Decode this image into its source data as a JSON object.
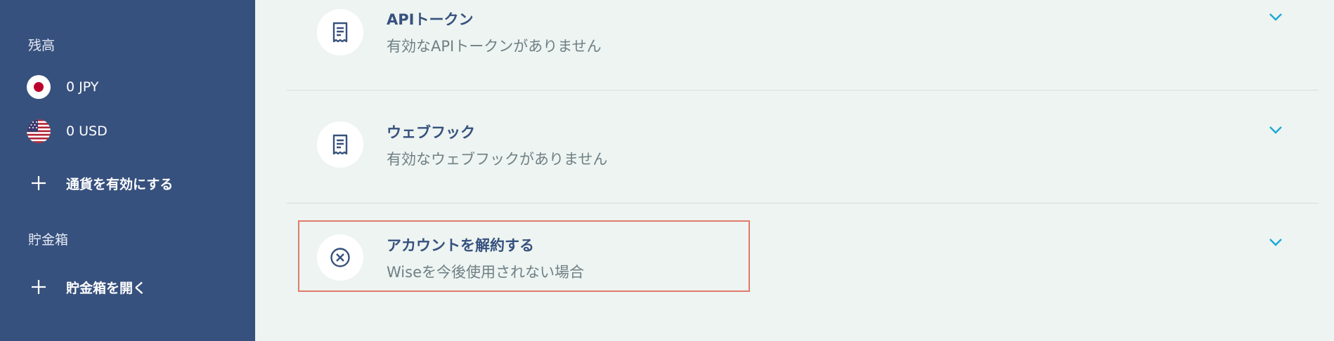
{
  "sidebar": {
    "balance_heading": "残高",
    "currencies": [
      {
        "label": "0 JPY",
        "flag": "jp-flag-icon"
      },
      {
        "label": "0 USD",
        "flag": "us-flag-icon"
      }
    ],
    "enable_currency": "通貨を有効にする",
    "jars_heading": "貯金箱",
    "open_jar": "貯金箱を開く"
  },
  "main": {
    "sections": [
      {
        "title": "APIトークン",
        "subtitle": "有効なAPIトークンがありません",
        "icon": "receipt-icon"
      },
      {
        "title": "ウェブフック",
        "subtitle": "有効なウェブフックがありません",
        "icon": "receipt-icon"
      },
      {
        "title": "アカウントを解約する",
        "subtitle": "Wiseを今後使用されない場合",
        "icon": "close-circle-icon"
      }
    ]
  },
  "colors": {
    "sidebar_bg": "#37517e",
    "main_bg": "#edf4f1",
    "accent_chevron": "#1aa9d6",
    "highlight_border": "#e07b6a",
    "title_text": "#37517e"
  }
}
